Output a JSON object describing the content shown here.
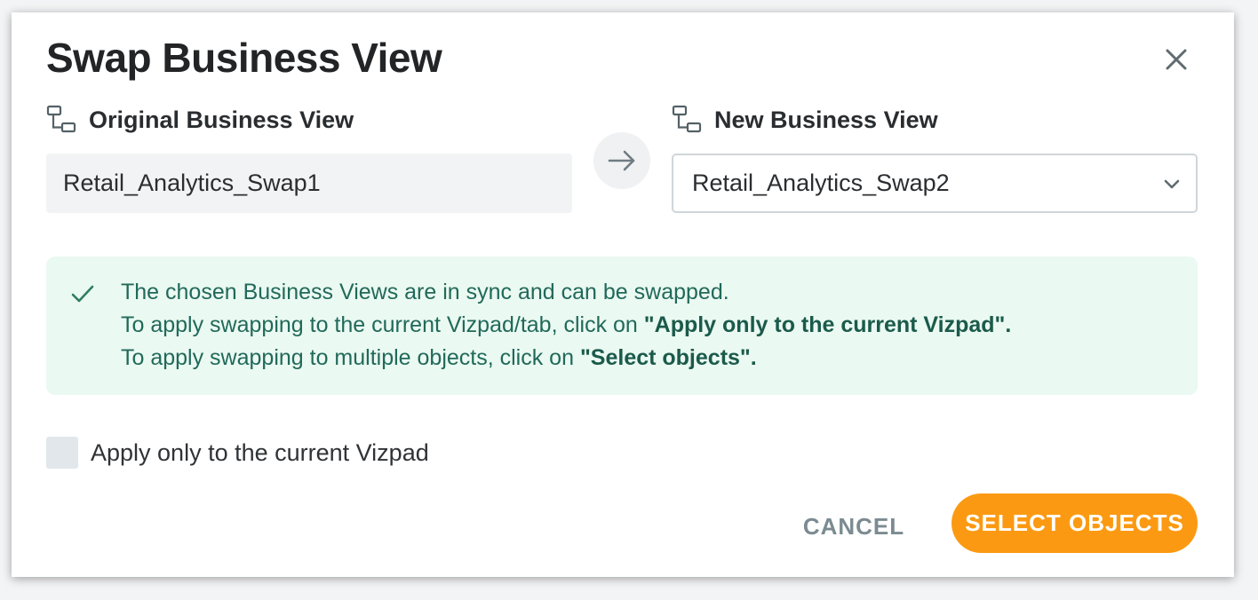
{
  "dialog": {
    "title": "Swap Business View",
    "close_icon": "close-icon"
  },
  "original": {
    "label": "Original Business View",
    "icon": "business-view-icon",
    "value": "Retail_Analytics_Swap1"
  },
  "arrow_icon": "arrow-right-icon",
  "new_view": {
    "label": "New Business View",
    "icon": "business-view-icon",
    "selected": "Retail_Analytics_Swap2",
    "chevron_icon": "chevron-down-icon"
  },
  "info": {
    "icon": "check-icon",
    "line1": "The chosen Business Views are in sync and can be swapped.",
    "line2_prefix": "To apply swapping to the current Vizpad/tab, click on ",
    "line2_bold": "\"Apply only to the current Vizpad\"",
    "line2_suffix": ".",
    "line3_prefix": "To apply swapping to multiple objects, click on ",
    "line3_bold": "\"Select objects\"",
    "line3_suffix": "."
  },
  "checkbox": {
    "label": "Apply only to the current Vizpad",
    "checked": false
  },
  "actions": {
    "cancel": "CANCEL",
    "select_objects": "SELECT OBJECTS"
  },
  "colors": {
    "accent": "#fb9a12",
    "info_bg": "#eaf9f1",
    "info_text": "#21695a"
  }
}
